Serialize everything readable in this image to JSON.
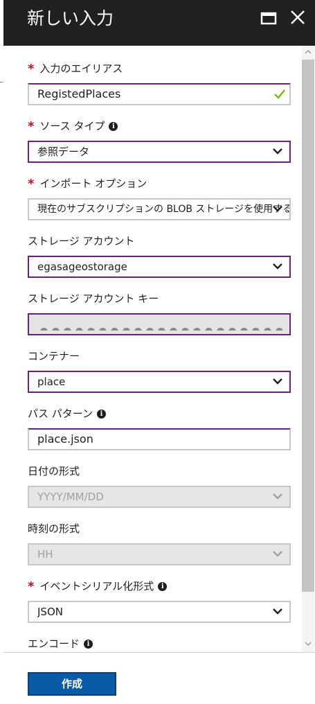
{
  "window": {
    "title": "新しい入力"
  },
  "fields": {
    "alias": {
      "label": "入力のエイリアス",
      "value": "RegistedPlaces"
    },
    "source_type": {
      "label": "ソース タイプ",
      "value": "参照データ"
    },
    "import_option": {
      "label": "インポート オプション",
      "value": "現在のサブスクリプションの BLOB ストレージを使用する"
    },
    "storage_account": {
      "label": "ストレージ アカウント",
      "value": "egasageostorage"
    },
    "storage_key": {
      "label": "ストレージ アカウント キー",
      "masked": "●●●●●●●●●●●●●●●●●●●●●"
    },
    "container": {
      "label": "コンテナー",
      "value": "place"
    },
    "path_pattern": {
      "label": "パス パターン",
      "value": "place.json"
    },
    "date_format": {
      "label": "日付の形式",
      "value": "YYYY/MM/DD"
    },
    "time_format": {
      "label": "時刻の形式",
      "value": "HH"
    },
    "serialization": {
      "label": "イベントシリアル化形式",
      "value": "JSON"
    },
    "encoding": {
      "label": "エンコード"
    }
  },
  "required_mark": "*",
  "info_mark": "i",
  "footer": {
    "create_label": "作成"
  },
  "colors": {
    "accent": "#68217a",
    "required": "#c50f1f",
    "button": "#0a5ba7",
    "titlebar": "#202020",
    "valid": "#6bb700"
  }
}
